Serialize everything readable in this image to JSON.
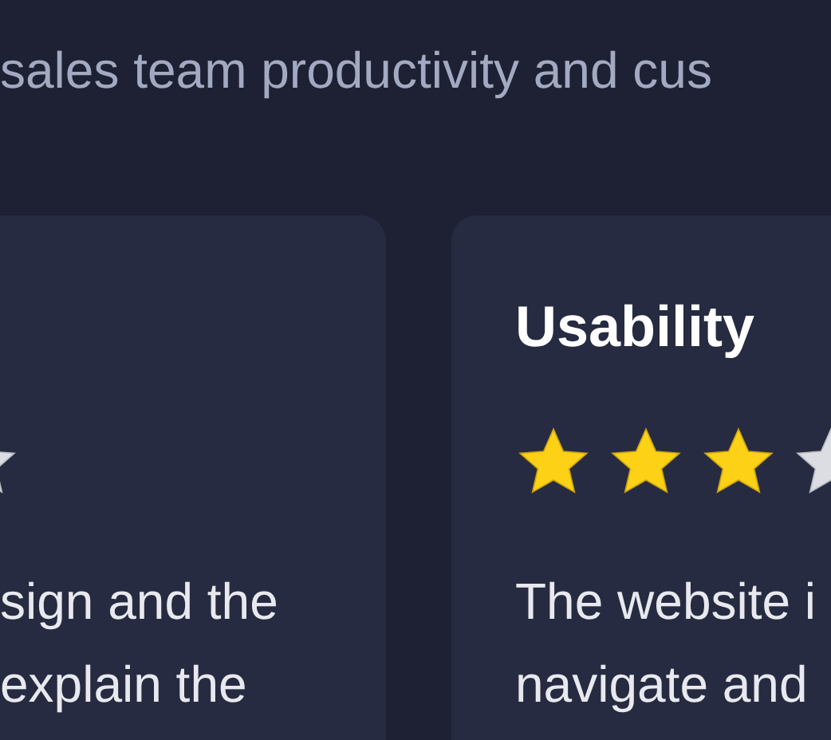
{
  "intro": "sales team productivity and cus",
  "cards": [
    {
      "lines": [
        "sign and the",
        "explain the"
      ]
    },
    {
      "title": "Usability",
      "stars": 3,
      "lines": [
        "The website i",
        "navigate and"
      ]
    }
  ]
}
